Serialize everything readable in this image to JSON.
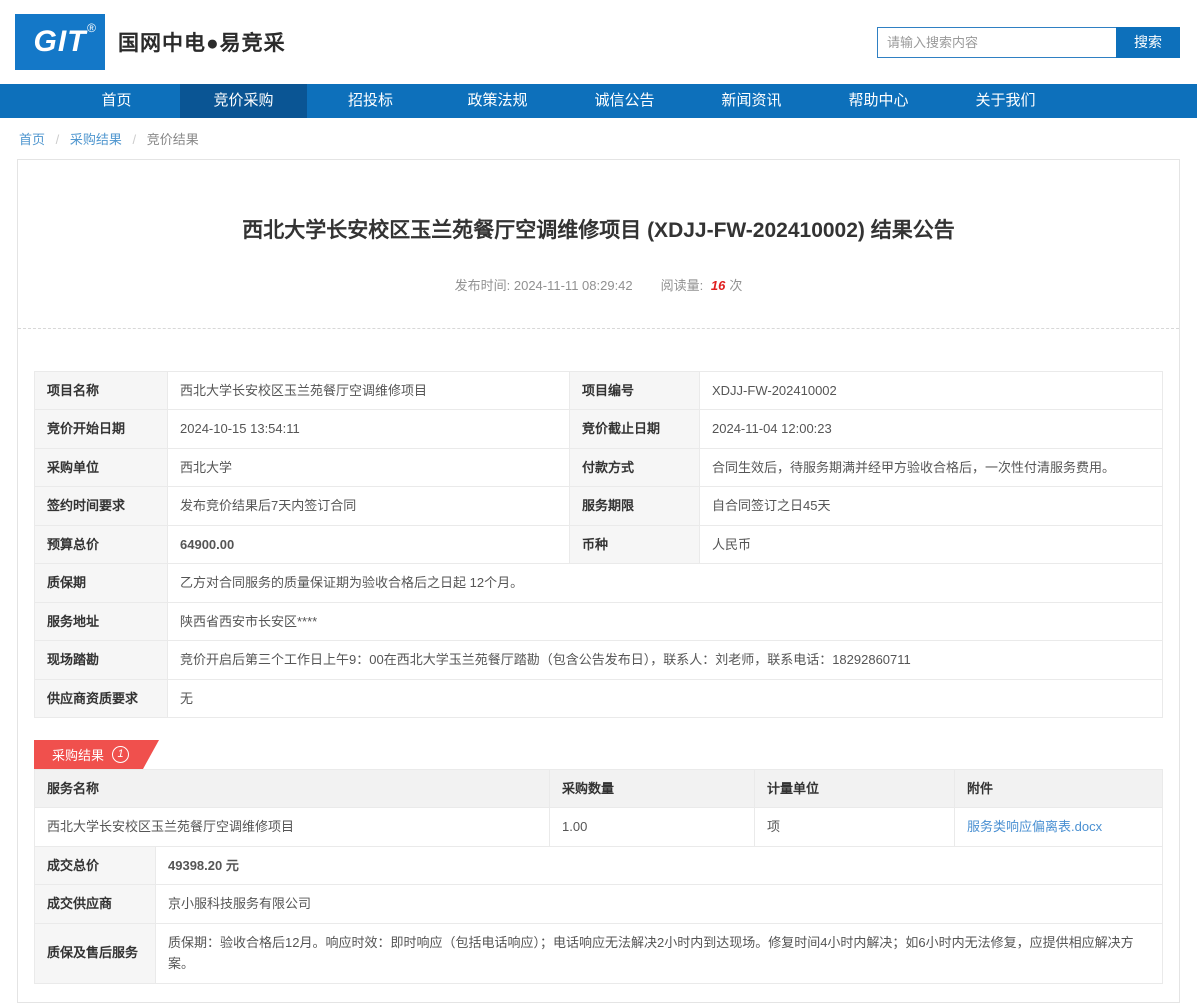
{
  "colors": {
    "primary_blue": "#0d70bb",
    "nav_active_blue": "#0a5594",
    "logo_blue": "#1478c8",
    "accent_red": "#f03c3c",
    "badge_red": "#f0504d",
    "link_blue": "#4a90d2"
  },
  "header": {
    "logo_text": "GIT",
    "logo_reg": "®",
    "brand": "国网中电●易竞采",
    "search_placeholder": "请输入搜索内容",
    "search_button": "搜索"
  },
  "nav": {
    "items": [
      {
        "label": "首页"
      },
      {
        "label": "竞价采购"
      },
      {
        "label": "招投标"
      },
      {
        "label": "政策法规"
      },
      {
        "label": "诚信公告"
      },
      {
        "label": "新闻资讯"
      },
      {
        "label": "帮助中心"
      },
      {
        "label": "关于我们"
      }
    ]
  },
  "breadcrumb": {
    "items": [
      "首页",
      "采购结果",
      "竞价结果"
    ],
    "separator": "/"
  },
  "article": {
    "title": "西北大学长安校区玉兰苑餐厅空调维修项目 (XDJJ-FW-202410002) 结果公告",
    "publish_label": "发布时间: ",
    "publish_time": "2024-11-11 08:29:42",
    "views_label": "阅读量: ",
    "views_count": "16",
    "views_unit": "次"
  },
  "project_table": {
    "rows": [
      {
        "l": "项目名称",
        "v": "西北大学长安校区玉兰苑餐厅空调维修项目",
        "l2": "项目编号",
        "v2": "XDJJ-FW-202410002"
      },
      {
        "l": "竞价开始日期",
        "v": "2024-10-15 13:54:11",
        "l2": "竞价截止日期",
        "v2": "2024-11-04 12:00:23"
      },
      {
        "l": "采购单位",
        "v": "西北大学",
        "l2": "付款方式",
        "v2": "合同生效后，待服务期满并经甲方验收合格后，一次性付清服务费用。"
      },
      {
        "l": "签约时间要求",
        "v": "发布竞价结果后7天内签订合同",
        "l2": "服务期限",
        "v2": "自合同签订之日45天"
      },
      {
        "l": "预算总价",
        "v": "64900.00",
        "l2": "币种",
        "v2": "人民币"
      }
    ],
    "full_rows": [
      {
        "l": "质保期",
        "v": "乙方对合同服务的质量保证期为验收合格后之日起 12个月。"
      },
      {
        "l": "服务地址",
        "v": "陕西省西安市长安区****"
      },
      {
        "l": "现场踏勘",
        "v": "竞价开启后第三个工作日上午9：00在西北大学玉兰苑餐厅踏勘（包含公告发布日），联系人：刘老师，联系电话：18292860711"
      },
      {
        "l": "供应商资质要求",
        "v": "无"
      }
    ]
  },
  "result_section": {
    "badge_label": "采购结果",
    "badge_count": "1",
    "headers": [
      "服务名称",
      "采购数量",
      "计量单位",
      "附件"
    ],
    "row": {
      "service_name": "西北大学长安校区玉兰苑餐厅空调维修项目",
      "quantity": "1.00",
      "unit": "项",
      "attachment": "服务类响应偏离表.docx"
    },
    "deal_rows": [
      {
        "l": "成交总价",
        "v": "49398.20 元"
      },
      {
        "l": "成交供应商",
        "v": "京小服科技服务有限公司"
      },
      {
        "l": "质保及售后服务",
        "v": "质保期：验收合格后12月。响应时效：即时响应（包括电话响应）；电话响应无法解决2小时内到达现场。修复时间4小时内解决；如6小时内无法修复，应提供相应解决方案。"
      }
    ]
  }
}
